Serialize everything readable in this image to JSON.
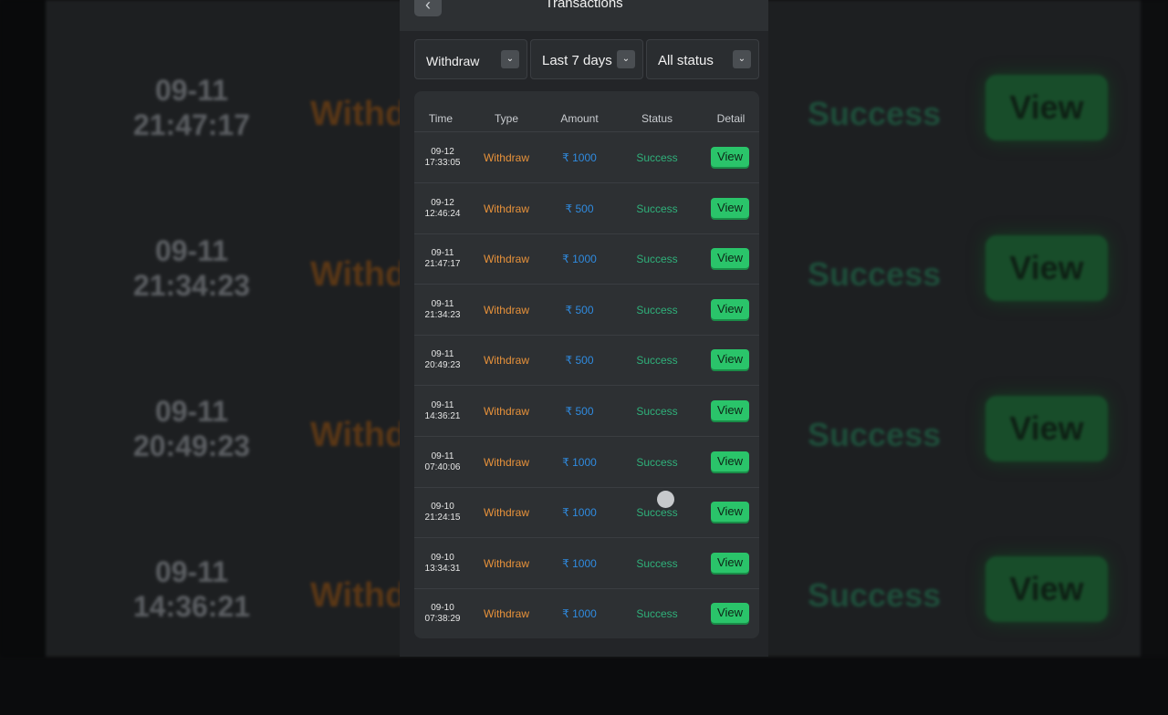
{
  "header": {
    "title": "Transactions",
    "back_icon": "chevron-left-icon"
  },
  "filters": [
    {
      "label": "Withdraw"
    },
    {
      "label": "Last 7 days"
    },
    {
      "label": "All status"
    }
  ],
  "table": {
    "columns": [
      "Time",
      "Type",
      "Amount",
      "Status",
      "Detail"
    ],
    "rows": [
      {
        "date": "09-12",
        "time": "17:33:05",
        "type": "Withdraw",
        "amount": "₹ 1000",
        "status": "Success",
        "detail": "View"
      },
      {
        "date": "09-12",
        "time": "12:46:24",
        "type": "Withdraw",
        "amount": "₹ 500",
        "status": "Success",
        "detail": "View"
      },
      {
        "date": "09-11",
        "time": "21:47:17",
        "type": "Withdraw",
        "amount": "₹ 1000",
        "status": "Success",
        "detail": "View"
      },
      {
        "date": "09-11",
        "time": "21:34:23",
        "type": "Withdraw",
        "amount": "₹ 500",
        "status": "Success",
        "detail": "View"
      },
      {
        "date": "09-11",
        "time": "20:49:23",
        "type": "Withdraw",
        "amount": "₹ 500",
        "status": "Success",
        "detail": "View"
      },
      {
        "date": "09-11",
        "time": "14:36:21",
        "type": "Withdraw",
        "amount": "₹ 500",
        "status": "Success",
        "detail": "View"
      },
      {
        "date": "09-11",
        "time": "07:40:06",
        "type": "Withdraw",
        "amount": "₹ 1000",
        "status": "Success",
        "detail": "View"
      },
      {
        "date": "09-10",
        "time": "21:24:15",
        "type": "Withdraw",
        "amount": "₹ 1000",
        "status": "Success",
        "detail": "View"
      },
      {
        "date": "09-10",
        "time": "13:34:31",
        "type": "Withdraw",
        "amount": "₹ 1000",
        "status": "Success",
        "detail": "View"
      },
      {
        "date": "09-10",
        "time": "07:38:29",
        "type": "Withdraw",
        "amount": "₹ 1000",
        "status": "Success",
        "detail": "View"
      }
    ]
  },
  "background_echo": [
    {
      "date": "09-11",
      "time": "21:47:17",
      "type": "Withdraw",
      "status": "Success",
      "detail": "View"
    },
    {
      "date": "09-11",
      "time": "21:34:23",
      "type": "Withdraw",
      "status": "Success",
      "detail": "View"
    },
    {
      "date": "09-11",
      "time": "20:49:23",
      "type": "Withdraw",
      "status": "Success",
      "detail": "View"
    },
    {
      "date": "09-11",
      "time": "14:36:21",
      "type": "Withdraw",
      "status": "Success",
      "detail": "View"
    }
  ],
  "colors": {
    "type": "#e8923a",
    "amount": "#2f8be0",
    "status": "#2fb07a",
    "view_button": "#2ac46a"
  }
}
